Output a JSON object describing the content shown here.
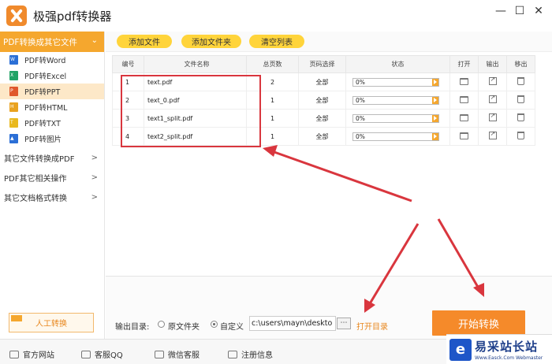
{
  "app": {
    "title": "极强pdf转换器"
  },
  "window": {
    "minimize": "—",
    "maximize": "☐",
    "close": "✕"
  },
  "sidebar": {
    "header": "PDF转换成其它文件",
    "items": [
      {
        "label": "PDF转Word",
        "icon": "word-icon",
        "color": "#2b6fd6",
        "tag": "W"
      },
      {
        "label": "PDF转Excel",
        "icon": "excel-icon",
        "color": "#21a366",
        "tag": "X"
      },
      {
        "label": "PDF转PPT",
        "icon": "ppt-icon",
        "color": "#e0572b",
        "tag": "P"
      },
      {
        "label": "PDF转HTML",
        "icon": "html-icon",
        "color": "#e9a21f",
        "tag": "H"
      },
      {
        "label": "PDF转TXT",
        "icon": "txt-icon",
        "color": "#e9b91f",
        "tag": "T"
      },
      {
        "label": "PDF转图片",
        "icon": "image-icon",
        "color": "#2b6fd6",
        "tag": "▲"
      }
    ],
    "groups": [
      "其它文件转换成PDF",
      "PDF其它相关操作",
      "其它文档格式转换"
    ],
    "group_chevron": ">",
    "manual_button": "人工转换"
  },
  "toolbar": {
    "add_file": "添加文件",
    "add_folder": "添加文件夹",
    "clear_list": "清空列表"
  },
  "table": {
    "headers": [
      "编号",
      "文件名称",
      "总页数",
      "页码选择",
      "状态",
      "打开",
      "输出",
      "移出"
    ],
    "rows": [
      {
        "num": "1",
        "name": "text.pdf",
        "pages": "2",
        "range": "全部",
        "status": "0%"
      },
      {
        "num": "2",
        "name": "text_0.pdf",
        "pages": "1",
        "range": "全部",
        "status": "0%"
      },
      {
        "num": "3",
        "name": "text1_split.pdf",
        "pages": "1",
        "range": "全部",
        "status": "0%"
      },
      {
        "num": "4",
        "name": "text2_split.pdf",
        "pages": "1",
        "range": "全部",
        "status": "0%"
      }
    ]
  },
  "output": {
    "label": "输出目录:",
    "option_original": "原文件夹",
    "option_custom": "自定义",
    "selected": "自定义",
    "path": "c:\\users\\mayn\\deskto",
    "browse": "⋯",
    "open_dir": "打开目录",
    "start": "开始转换"
  },
  "footer": {
    "website": "官方网站",
    "qq": "客服QQ",
    "wechat": "微信客服",
    "register": "注册信息"
  },
  "watermark": {
    "logo": "e",
    "cn": "易采站长站",
    "en": "Www.Easck.Com Webmaster"
  },
  "colors": {
    "accent": "#f5a72e",
    "start": "#f58a2a",
    "highlight": "#d9363e",
    "toolbar_btn": "#ffd43b"
  }
}
